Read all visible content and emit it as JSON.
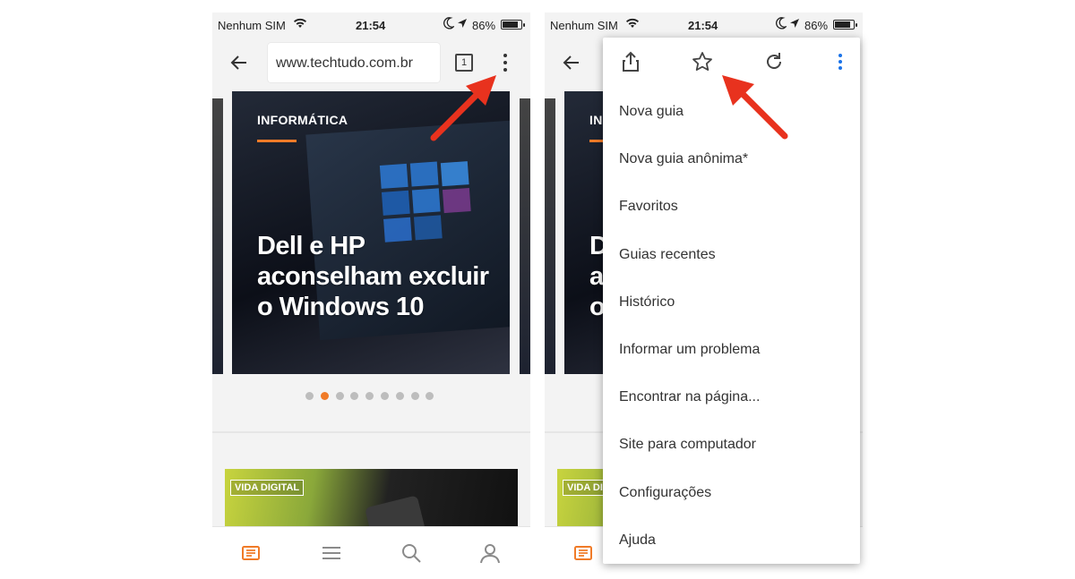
{
  "status_bar": {
    "carrier": "Nenhum SIM",
    "time": "21:54",
    "battery_percent": "86%",
    "battery_level": 0.86
  },
  "toolbar": {
    "url": "www.techtudo.com.br",
    "tab_count": "1"
  },
  "hero_card": {
    "category": "INFORMÁTICA",
    "title": "Dell e HP aconselham excluir o Windows 10"
  },
  "carousel": {
    "page_count": 9,
    "active_index": 1
  },
  "second_card": {
    "label": "VIDA DIGITAL"
  },
  "bottom_nav": {
    "icons": [
      "news-icon",
      "menu-icon",
      "search-icon",
      "user-icon"
    ]
  },
  "menu": {
    "action_icons": [
      "share-icon",
      "star-icon",
      "reload-icon",
      "more-vertical-icon"
    ],
    "items": [
      "Nova guia",
      "Nova guia anônima*",
      "Favoritos",
      "Guias recentes",
      "Histórico",
      "Informar um problema",
      "Encontrar na página...",
      "Site para computador",
      "Configurações",
      "Ajuda"
    ]
  },
  "colors": {
    "accent_orange": "#f07b28",
    "arrow_red": "#e8321e",
    "menu_blue": "#1a73e8"
  }
}
